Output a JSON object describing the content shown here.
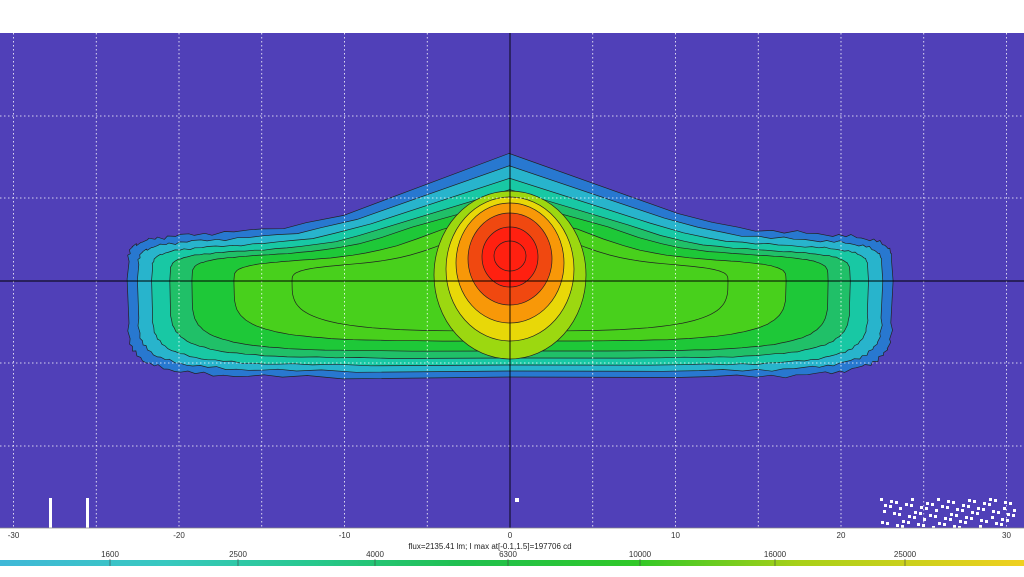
{
  "chart_data": {
    "type": "heatmap",
    "title": "",
    "xlabel": "",
    "ylabel": "",
    "xlim": [
      -30.5,
      31
    ],
    "ylim": [
      -15,
      15
    ],
    "x_ticks": [
      -30,
      -20,
      -10,
      0,
      10,
      20,
      30
    ],
    "x_tick_labels": [
      "-30",
      "-20",
      "-10",
      "0",
      "10",
      "20",
      "30"
    ],
    "grid": true,
    "status_line": "flux=2135.41 lm; I max at[-0.1,1.5]=197706 cd",
    "peak": {
      "x": -0.1,
      "y": 1.5,
      "value": 197706,
      "unit": "cd"
    },
    "color_scale": {
      "levels": [
        1000,
        1600,
        2500,
        4000,
        6300,
        10000,
        16000,
        25000,
        40000
      ],
      "labels": [
        "1600",
        "2500",
        "4000",
        "6300",
        "10000",
        "16000",
        "25000"
      ]
    },
    "colors": {
      "background": "#5040b8",
      "levels": [
        "#2878d0",
        "#28b4cc",
        "#18c8a4",
        "#20c068",
        "#1ec838",
        "#48d01c",
        "#9cd810",
        "#e8d808",
        "#f89808",
        "#f04810",
        "#ff2010"
      ],
      "contour": "#222222",
      "axis": "#000000",
      "grid": "#ffffff"
    }
  }
}
